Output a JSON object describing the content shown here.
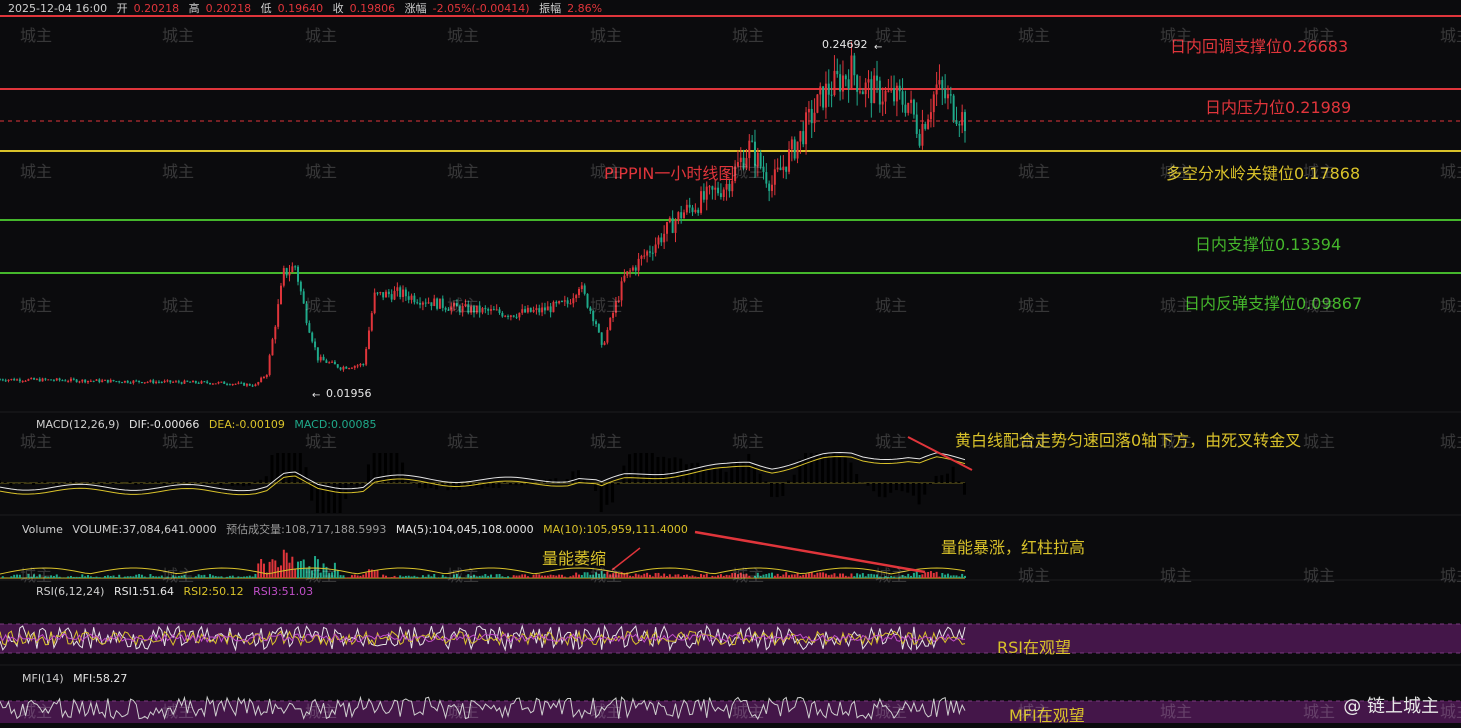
{
  "header": {
    "datetime": "2025-12-04 16:00",
    "open_label": "开",
    "open": "0.20218",
    "high_label": "高",
    "high": "0.20218",
    "low_label": "低",
    "low": "0.19640",
    "close_label": "收",
    "close": "0.19806",
    "change_label": "涨幅",
    "change": "-2.05%(-0.00414)",
    "amp_label": "振幅",
    "amp": "2.86%"
  },
  "main_title": "PIPPIN一小时线图",
  "levels": [
    {
      "label": "日内回调支撑位0.26683",
      "color": "#e0353b"
    },
    {
      "label": "日内压力位0.21989",
      "color": "#e0353b"
    },
    {
      "label": "多空分水岭关键位0.17868",
      "color": "#d9c22a"
    },
    {
      "label": "日内支撑位0.13394",
      "color": "#45b72c"
    },
    {
      "label": "日内反弹支撑位0.09867",
      "color": "#45b72c"
    }
  ],
  "price_marks": {
    "high": "0.24692",
    "low": "0.01956"
  },
  "macd": {
    "label": "MACD(12,26,9)",
    "dif": "DIF:-0.00066",
    "dea": "DEA:-0.00109",
    "macd": "MACD:0.00085",
    "note": "黄白线配合走势匀速回落0轴下方，由死叉转金叉"
  },
  "volume": {
    "label": "Volume",
    "vol": "VOLUME:37,084,641.0000",
    "est": "预估成交量:108,717,188.5993",
    "ma5": "MA(5):104,045,108.0000",
    "ma10": "MA(10):105,959,111.4000",
    "note_left": "量能萎缩",
    "note_right": "量能暴涨，红柱拉高"
  },
  "rsi": {
    "label": "RSI(6,12,24)",
    "rsi1": "RSI1:51.64",
    "rsi2": "RSI2:50.12",
    "rsi3": "RSI3:51.03",
    "note": "RSI在观望"
  },
  "mfi": {
    "label": "MFI(14)",
    "value": "MFI:58.27",
    "note": "MFI在观望"
  },
  "watermark": "城主",
  "logo": "@ 链上城主",
  "colors": {
    "up": "#e0353b",
    "down": "#1fa98a",
    "yellow": "#d9c22a",
    "white": "#e6e6e6",
    "purple": "#4a1750"
  },
  "chart_data": {
    "type": "candlestick",
    "title": "PIPPIN一小时线图",
    "close_path": [
      [
        0,
        0.024
      ],
      [
        10,
        0.0235
      ],
      [
        20,
        0.0228
      ],
      [
        30,
        0.0222
      ],
      [
        40,
        0.0215
      ],
      [
        45,
        0.02
      ],
      [
        47,
        0.028
      ],
      [
        50,
        0.095
      ],
      [
        52,
        0.1
      ],
      [
        54,
        0.065
      ],
      [
        56,
        0.038
      ],
      [
        60,
        0.032
      ],
      [
        64,
        0.034
      ],
      [
        66,
        0.08
      ],
      [
        70,
        0.082
      ],
      [
        80,
        0.072
      ],
      [
        90,
        0.068
      ],
      [
        95,
        0.07
      ],
      [
        100,
        0.075
      ],
      [
        102,
        0.088
      ],
      [
        105,
        0.062
      ],
      [
        106,
        0.045
      ],
      [
        110,
        0.092
      ],
      [
        120,
        0.135
      ],
      [
        128,
        0.155
      ],
      [
        132,
        0.18
      ],
      [
        136,
        0.155
      ],
      [
        140,
        0.18
      ],
      [
        145,
        0.215
      ],
      [
        150,
        0.232
      ],
      [
        152,
        0.22
      ],
      [
        160,
        0.21
      ],
      [
        162,
        0.19
      ],
      [
        165,
        0.22
      ],
      [
        170,
        0.198
      ]
    ],
    "high_label": 0.24692,
    "low_label": 0.01956,
    "ylim": [
      0.0,
      0.28
    ]
  }
}
